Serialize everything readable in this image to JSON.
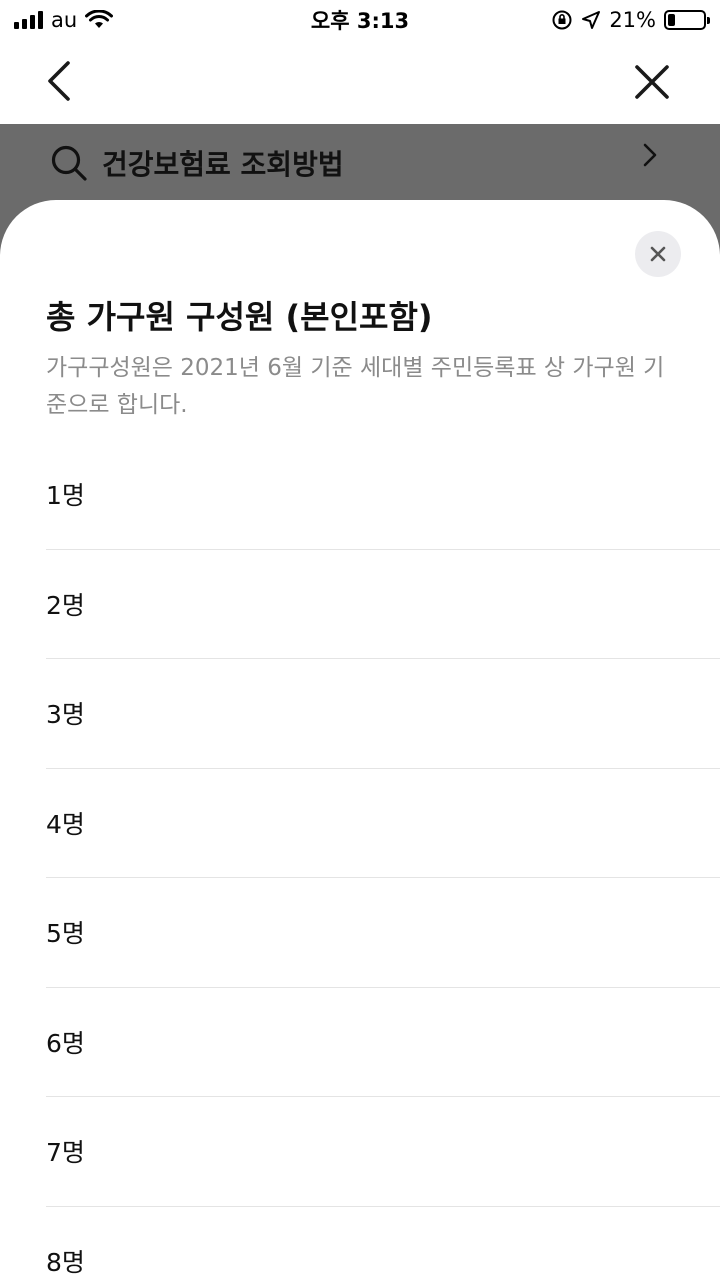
{
  "status_bar": {
    "carrier": "au",
    "time": "오후 3:13",
    "battery_text": "21%",
    "battery_level": 0.21,
    "icons": [
      "signal-icon",
      "wifi-icon",
      "orientation-lock-icon",
      "location-icon",
      "battery-icon"
    ]
  },
  "nav": {
    "back_icon": "chevron-left-icon",
    "close_icon": "close-icon"
  },
  "search": {
    "icon": "search-icon",
    "label": "건강보험료 조회방법",
    "chevron_icon": "chevron-right-icon"
  },
  "sheet": {
    "close_icon": "close-icon",
    "title": "총 가구원 구성원 (본인포함)",
    "description": "가구구성원은 2021년 6월 기준 세대별 주민등록표 상 가구원 기준으로 합니다.",
    "options": [
      "1명",
      "2명",
      "3명",
      "4명",
      "5명",
      "6명",
      "7명",
      "8명"
    ]
  },
  "colors": {
    "dim_overlay": "#6b6b6b",
    "desc_text": "#8b8b8b",
    "divider": "#e4e4e4",
    "close_bg": "#ececef"
  }
}
